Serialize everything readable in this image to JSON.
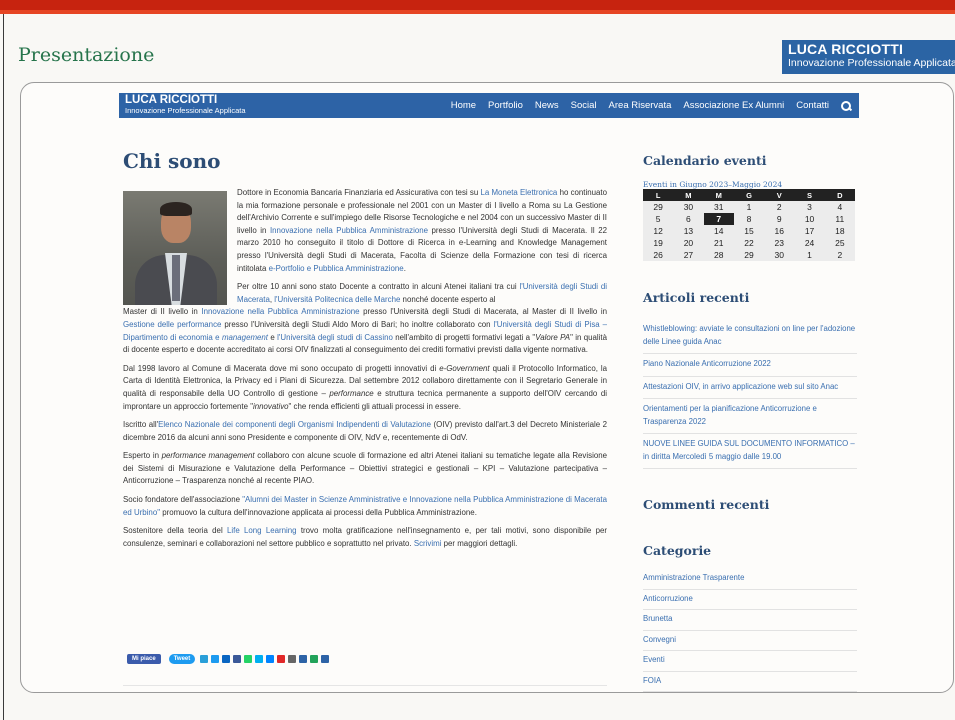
{
  "slide": {
    "title": "Presentazione",
    "brand_name": "LUCA RICCIOTTI",
    "brand_sub": "Innovazione Professionale Applicata"
  },
  "colors": {
    "accent_red": "#c7230f",
    "brand_blue": "#2d63a6",
    "link_blue": "#3a6fb0",
    "heading": "#2d4d75",
    "slide_title_green": "#26744b"
  },
  "nav": {
    "brand_name": "LUCA RICCIOTTI",
    "brand_sub": "Innovazione Professionale Applicata",
    "links": [
      "Home",
      "Portfolio",
      "News",
      "Social",
      "Area Riservata",
      "Associazione Ex Alumni",
      "Contatti"
    ],
    "search_icon": "search-icon"
  },
  "page": {
    "title": "Chi sono"
  },
  "article": {
    "p1": [
      {
        "t": "Dottore in Economia Bancaria Finanziaria ed Assicurativa con tesi su "
      },
      {
        "t": "La Moneta Elettronica",
        "link": true
      },
      {
        "t": " ho continuato la mia formazione personale e professionale nel 2001 con un Master di I livello a Roma su La Gestione dell'Archivio Corrente e sull'impiego delle Risorse Tecnologiche e nel 2004 con un successivo Master di II livello in "
      },
      {
        "t": "Innovazione nella Pubblica Amministrazione",
        "link": true
      },
      {
        "t": " presso l'Università degli Studi di Macerata. Il 22 marzo 2010 ho conseguito il titolo di Dottore di Ricerca in e-Learning and Knowledge Management presso l'Università degli Studi di Macerata, Facolta di Scienze della Formazione con tesi di ricerca intitolata "
      },
      {
        "t": "e-Portfolio e Pubblica Amministrazione",
        "link": true
      },
      {
        "t": "."
      }
    ],
    "p2a": [
      {
        "t": "Per oltre 10 anni sono stato Docente a contratto in alcuni Atenei italiani tra cui "
      },
      {
        "t": "l'Università degli Studi di Macerata",
        "link": true
      },
      {
        "t": ", "
      },
      {
        "t": "l'Università Politecnica delle Marche",
        "link": true
      },
      {
        "t": " nonché docente esperto al"
      }
    ],
    "p2b": [
      {
        "t": "Master di II livello in "
      },
      {
        "t": "Innovazione nella Pubblica Amministrazione",
        "link": true
      },
      {
        "t": " presso l'Università degli Studi di Macerata, al Master di II livello in "
      },
      {
        "t": "Gestione delle performance",
        "link": true
      },
      {
        "t": " presso l'Università degli Studi Aldo Moro di Bari; ho inoltre collaborato con "
      },
      {
        "t": "l'Università degli Studi di Pisa – Dipartimento di economia e ",
        "link": true
      },
      {
        "t": "management",
        "link": true,
        "em": true
      },
      {
        "t": " e "
      },
      {
        "t": "l'Università degli studi di Cassino",
        "link": true
      },
      {
        "t": " nell'ambito di progetti formativi legati a \""
      },
      {
        "t": "Valore PA",
        "em": true
      },
      {
        "t": "\" in qualità di docente esperto e docente accreditato ai corsi OIV finalizzati al conseguimento dei crediti formativi previsti dalla vigente normativa."
      }
    ],
    "p3": [
      {
        "t": "Dal 1998 lavoro al Comune di Macerata dove mi sono occupato di progetti innovativi di "
      },
      {
        "t": "e-Government",
        "em": true
      },
      {
        "t": " quali il Protocollo Informatico, la Carta di Identità Elettronica, la Privacy ed i Piani di Sicurezza. Dal settembre 2012 collaboro direttamente con il Segretario Generale in qualità di responsabile della UO Controllo di gestione – "
      },
      {
        "t": "performance",
        "em": true
      },
      {
        "t": " e struttura tecnica permanente a supporto dell'OIV cercando di improntare un approccio fortemente \""
      },
      {
        "t": "innovativo",
        "em": true
      },
      {
        "t": "\" che renda efficienti gli attuali processi in essere."
      }
    ],
    "p4": [
      {
        "t": "Iscritto all'"
      },
      {
        "t": "Elenco Nazionale dei componenti degli Organismi Indipendenti di Valutazione",
        "link": true
      },
      {
        "t": " (OIV) previsto dall'art.3 del Decreto Ministeriale 2 dicembre 2016 da alcuni anni sono Presidente e componente di OIV, NdV e, recentemente di OdV."
      }
    ],
    "p5": [
      {
        "t": "Esperto in "
      },
      {
        "t": "performance management",
        "em": true
      },
      {
        "t": " collaboro con alcune scuole di formazione ed altri Atenei italiani su tematiche legate alla Revisione dei Sistemi di Misurazione e Valutazione della Performance – Obiettivi strategici e gestionali – KPI – Valutazione partecipativa – Anticorruzione – Trasparenza nonché al recente PIAO."
      }
    ],
    "p6": [
      {
        "t": "Socio fondatore dell'associazione "
      },
      {
        "t": "\"Alumni dei Master in Scienze Amministrative e Innovazione nella Pubblica Amministrazione di Macerata ed Urbino\"",
        "link": true
      },
      {
        "t": " promuovo la cultura dell'innovazione applicata ai processi della Pubblica Amministrazione."
      }
    ],
    "p7": [
      {
        "t": "Sostenitore della teoria del "
      },
      {
        "t": "Life Long Learning",
        "link": true
      },
      {
        "t": " trovo molta gratificazione nell'insegnamento e, per tali motivi, sono disponibile per consulenze, seminari e collaborazioni nel settore pubblico e soprattutto nel privato. "
      },
      {
        "t": "Scrivimi",
        "link": true
      },
      {
        "t": " per maggiori dettagli."
      }
    ]
  },
  "share": {
    "like_label": "Mi piace",
    "tweet_label": "Tweet",
    "icons": [
      {
        "name": "telegram-icon",
        "color": "#2a9fd8"
      },
      {
        "name": "twitter-icon",
        "color": "#1d9bf0"
      },
      {
        "name": "linkedin-icon",
        "color": "#0a66c2"
      },
      {
        "name": "facebook-icon",
        "color": "#3b5998"
      },
      {
        "name": "whatsapp-icon",
        "color": "#25d366"
      },
      {
        "name": "skype-icon",
        "color": "#00aff0"
      },
      {
        "name": "messenger-icon",
        "color": "#0084ff"
      },
      {
        "name": "flipboard-icon",
        "color": "#e12828"
      },
      {
        "name": "email-icon",
        "color": "#666666"
      },
      {
        "name": "copy-link-icon",
        "color": "#2d63a6"
      },
      {
        "name": "sms-icon",
        "color": "#22a35a"
      },
      {
        "name": "share-plus-icon",
        "color": "#2d63a6"
      }
    ]
  },
  "sidebar": {
    "calendar": {
      "title": "Calendario eventi",
      "caption": "Eventi in Giugno 2023–Maggio 2024",
      "days": [
        "L",
        "M",
        "M",
        "G",
        "V",
        "S",
        "D"
      ],
      "rows": [
        [
          "29",
          "30",
          "31",
          "1",
          "2",
          "3",
          "4"
        ],
        [
          "5",
          "6",
          "7",
          "8",
          "9",
          "10",
          "11"
        ],
        [
          "12",
          "13",
          "14",
          "15",
          "16",
          "17",
          "18"
        ],
        [
          "19",
          "20",
          "21",
          "22",
          "23",
          "24",
          "25"
        ],
        [
          "26",
          "27",
          "28",
          "29",
          "30",
          "1",
          "2"
        ]
      ],
      "today": "7"
    },
    "recent_posts": {
      "title": "Articoli recenti",
      "items": [
        "Whistleblowing: avviate le consultazioni on line per l'adozione delle Linee guida Anac",
        "Piano Nazionale Anticorruzione 2022",
        "Attestazioni OIV, in arrivo applicazione web sul sito Anac",
        "Orientamenti per la pianificazione Anticorruzione e Trasparenza 2022",
        "NUOVE LINEE GUIDA SUL DOCUMENTO INFORMATICO – in diritta Mercoledì 5 maggio dalle 19.00"
      ]
    },
    "recent_comments": {
      "title": "Commenti recenti"
    },
    "categories": {
      "title": "Categorie",
      "items": [
        "Amministrazione Trasparente",
        "Anticorruzione",
        "Brunetta",
        "Convegni",
        "Eventi",
        "FOIA"
      ]
    }
  }
}
